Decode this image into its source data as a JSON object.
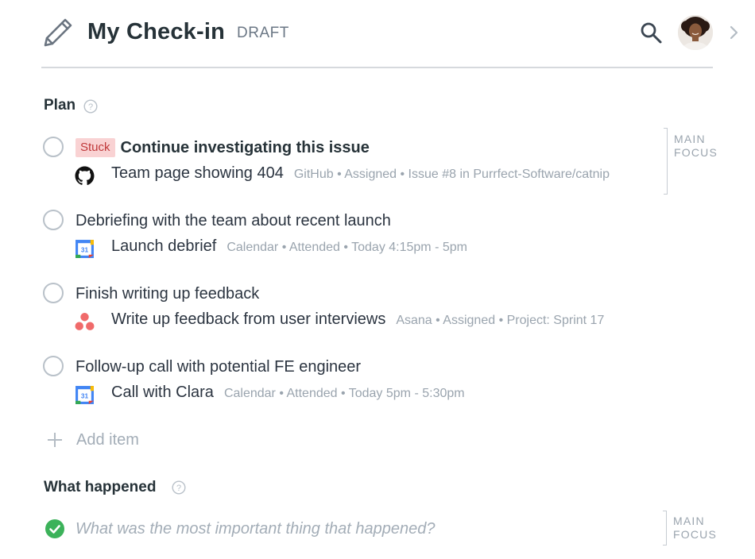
{
  "header": {
    "title": "My Check-in",
    "status": "DRAFT",
    "edit_icon": "pencil-icon",
    "search_icon": "search-icon",
    "avatar": "user-avatar",
    "next_icon": "chevron-right-icon"
  },
  "plan": {
    "heading": "Plan",
    "help_icon": "help-circle-icon",
    "main_focus_label_1": "MAIN",
    "main_focus_label_2": "FOCUS",
    "items": [
      {
        "badge": "Stuck",
        "title": "Continue investigating this issue",
        "source": "github-icon",
        "linked_title": "Team page showing 404",
        "meta": "GitHub • Assigned • Issue #8 in Purrfect-Software/catnip"
      },
      {
        "title": "Debriefing with the team about recent launch",
        "source": "google-calendar-icon",
        "linked_title": "Launch debrief",
        "meta": "Calendar • Attended • Today 4:15pm - 5pm"
      },
      {
        "title": "Finish writing up feedback",
        "source": "asana-icon",
        "linked_title": "Write up feedback from user interviews",
        "meta": "Asana • Assigned • Project: Sprint 17"
      },
      {
        "title": "Follow-up call with potential FE engineer",
        "source": "google-calendar-icon",
        "linked_title": "Call with Clara",
        "meta": "Calendar • Attended • Today 5pm - 5:30pm"
      }
    ],
    "add_item_label": "Add item"
  },
  "what_happened": {
    "heading": "What happened",
    "help_icon": "help-circle-icon",
    "placeholder": "What was the most important thing that happened?",
    "main_focus_label_1": "MAIN",
    "main_focus_label_2": "FOCUS"
  },
  "colors": {
    "stuck_bg": "#f9d2d3",
    "stuck_text": "#c0393b",
    "done_green": "#3cb25a",
    "meta_gray": "#9aa4ae"
  }
}
